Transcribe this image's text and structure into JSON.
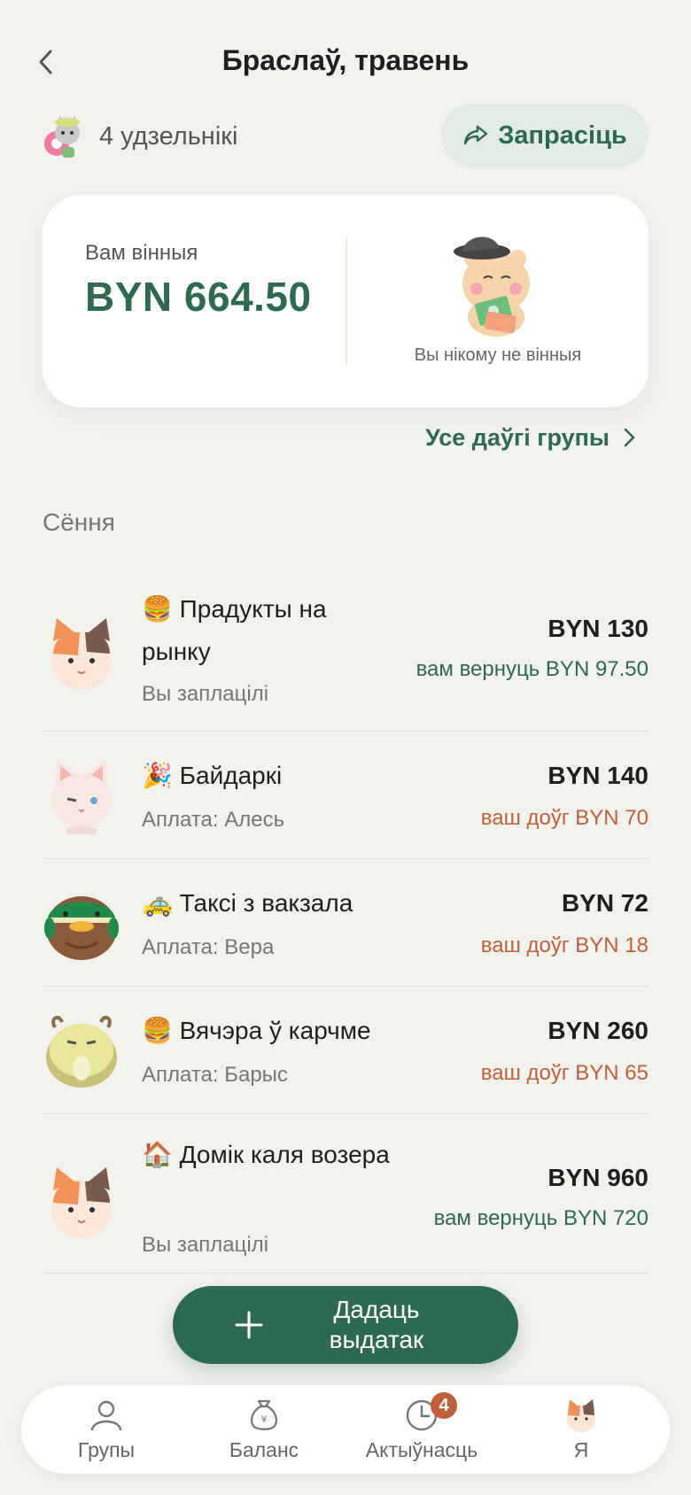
{
  "header": {
    "title": "Браслаў, травень",
    "members_label": "4 удзельнікі",
    "invite_label": "Запрасіць"
  },
  "summary": {
    "owed_label": "Вам вінныя",
    "owed_amount": "BYN 664.50",
    "no_debt_label": "Вы нікому не вінныя"
  },
  "other_groups_label": "Усе даўгі групы",
  "section_title": "Сёння",
  "expenses": [
    {
      "emoji": "🍔",
      "title": "Прадукты на рынку",
      "sub": "Вы заплацілі",
      "amount": "BYN 130",
      "share": "вам вернуць BYN 97.50",
      "share_type": "positive",
      "avatar": "calico-cat-icon"
    },
    {
      "emoji": "🎉",
      "title": "Байдаркі",
      "sub": "Аплата: Алесь",
      "amount": "BYN 140",
      "share": "ваш доўг BYN 70",
      "share_type": "negative",
      "avatar": "white-cat-icon"
    },
    {
      "emoji": "🚕",
      "title": "Таксі з вакзала",
      "sub": "Аплата: Вера",
      "amount": "BYN 72",
      "share": "ваш доўг BYN 18",
      "share_type": "negative",
      "avatar": "duck-icon"
    },
    {
      "emoji": "🍔",
      "title": "Вячэра ў карчме",
      "sub": "Аплата: Барыс",
      "amount": "BYN 260",
      "share": "ваш доўг BYN 65",
      "share_type": "negative",
      "avatar": "goat-icon"
    },
    {
      "emoji": "🏠",
      "title": "Домік каля возера",
      "sub": "Вы заплацілі",
      "amount": "BYN 960",
      "share": "вам вернуць BYN 720",
      "share_type": "positive",
      "avatar": "calico-cat-icon"
    }
  ],
  "add_button_label": "Дадаць выдатак",
  "tabs": [
    {
      "label": "Групы",
      "icon": "person-icon"
    },
    {
      "label": "Баланс",
      "icon": "money-bag-icon"
    },
    {
      "label": "Актыўнасць",
      "icon": "clock-icon",
      "badge": "4"
    },
    {
      "label": "Я",
      "icon": "profile-avatar-icon"
    }
  ],
  "colors": {
    "accent": "#2d6a4f",
    "accent_soft": "#e3ebe5",
    "negative": "#c0603a",
    "background": "#f4f2ee"
  }
}
